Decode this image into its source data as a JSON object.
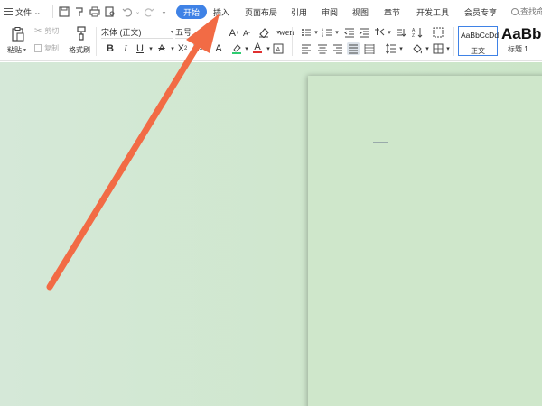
{
  "tabbar": {
    "menu_label": "文件",
    "tabs": [
      {
        "label": "开始",
        "active": true
      },
      {
        "label": "插入",
        "active": false
      },
      {
        "label": "页面布局",
        "active": false
      },
      {
        "label": "引用",
        "active": false
      },
      {
        "label": "审阅",
        "active": false
      },
      {
        "label": "视图",
        "active": false
      },
      {
        "label": "章节",
        "active": false
      },
      {
        "label": "开发工具",
        "active": false
      },
      {
        "label": "会员专享",
        "active": false
      }
    ],
    "search_label": "查找命"
  },
  "ribbon": {
    "paste_label": "粘贴",
    "cut_label": "剪切",
    "copy_label": "复制",
    "format_painter_label": "格式刷",
    "font_name": "宋体 (正文)",
    "font_size": "五号",
    "style_normal_sample": "AaBbCcDd",
    "style_normal_name": "正文",
    "style_heading_sample": "AaBb",
    "style_heading_name": "标题 1"
  },
  "colors": {
    "accent": "#3f82e6",
    "arrow": "#f26b45",
    "canvas": "#cfe7cd",
    "page": "#cfe7cb"
  }
}
